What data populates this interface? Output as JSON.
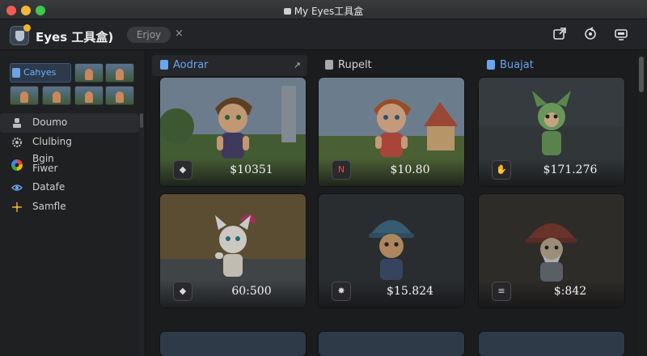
{
  "window": {
    "title": "My Eyes工具盒"
  },
  "app": {
    "name": "Eyes 工具盒)",
    "tab_label": "Erjoy",
    "tab_close": "×"
  },
  "header_actions": [
    "share-icon",
    "refresh-icon",
    "display-icon"
  ],
  "sidebar": {
    "thumb_label": "Cahyes",
    "items": [
      {
        "label": "Doumo",
        "icon": "bust-icon"
      },
      {
        "label": "Clulbing",
        "icon": "gear-icon"
      },
      {
        "label": "Bgin\nFiwer",
        "icon": "colorwheel-icon"
      },
      {
        "label": "Datafe",
        "icon": "eye-icon"
      },
      {
        "label": "Samfle",
        "icon": "sparkle-icon"
      }
    ]
  },
  "columns": [
    {
      "label": "Aodrar",
      "icon": "hand-icon",
      "pin": "↗"
    },
    {
      "label": "Rupelt",
      "icon": "box-icon"
    },
    {
      "label": "Buajat",
      "icon": "tag-icon"
    }
  ],
  "cards": [
    {
      "price": "$10351",
      "badge_icon": "shield-icon",
      "badge": "◆"
    },
    {
      "price": "$10.80",
      "badge_icon": "n-icon",
      "badge": "N"
    },
    {
      "price": "$171.276",
      "badge_icon": "hand-icon",
      "badge": "✋"
    },
    {
      "price": "60:500",
      "badge_icon": "shield-icon",
      "badge": "◆"
    },
    {
      "price": "$15.824",
      "badge_icon": "star-icon",
      "badge": "✸"
    },
    {
      "price": "$:842",
      "badge_icon": "list-icon",
      "badge": "≡"
    }
  ]
}
